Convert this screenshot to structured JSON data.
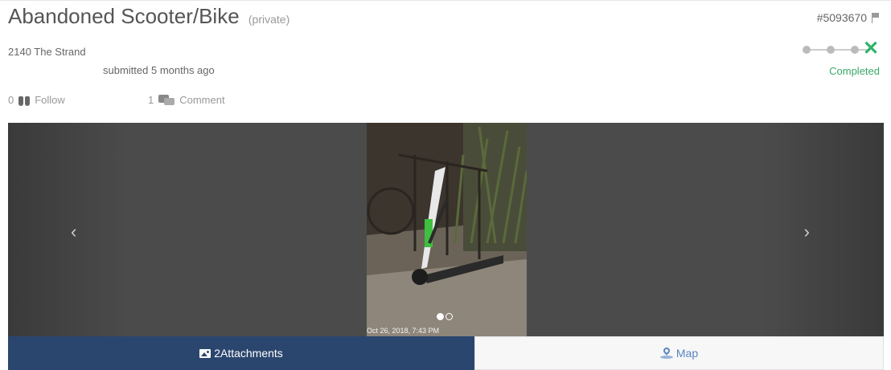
{
  "request": {
    "title": "Abandoned Scooter/Bike",
    "visibility": "(private)",
    "ticket_id": "#5093670",
    "address": "2140 The Strand",
    "submitted": "submitted 5 months ago"
  },
  "status": {
    "label": "Completed",
    "steps_total": 4,
    "steps_done": 4,
    "color": "#3aa869"
  },
  "stats": {
    "follow_count": "0",
    "follow_label": "Follow",
    "comment_count": "1",
    "comment_label": "Comment"
  },
  "carousel": {
    "prev_glyph": "‹",
    "next_glyph": "›",
    "photo_timestamp": "Oct 26, 2018, 7:43 PM",
    "slide_count": 2,
    "active_slide": 1
  },
  "tabs": {
    "attachments_label": "2Attachments",
    "map_label": "Map"
  },
  "colors": {
    "attachments_tab_bg": "#2b466e",
    "map_link": "#5a86c0",
    "completed_green": "#2fb36a"
  }
}
